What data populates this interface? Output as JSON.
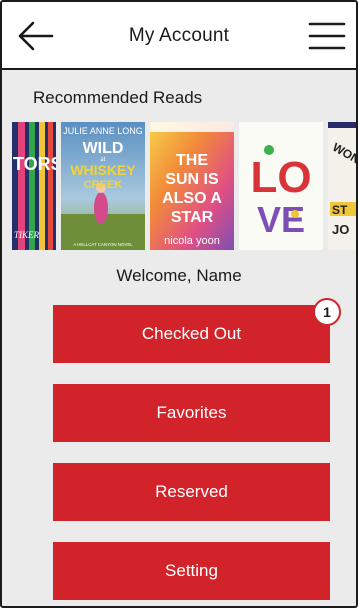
{
  "header": {
    "title": "My Account",
    "back_icon": "arrow-left-icon",
    "menu_icon": "hamburger-menu-icon"
  },
  "recommended": {
    "title": "Recommended Reads",
    "books": [
      {
        "cover_text": [
          "TORS",
          "TIKER"
        ]
      },
      {
        "cover_text": [
          "JULIE ANNE LONG",
          "WILD",
          "at",
          "WHISKEY",
          "CREEK",
          "A HELLCAT CANYON NOVEL"
        ]
      },
      {
        "cover_text": [
          "THE",
          "SUN IS",
          "ALSO A",
          "STAR",
          "nicola yoon"
        ]
      },
      {
        "cover_text": [
          "LO",
          "VE"
        ]
      },
      {
        "cover_text": [
          "WON",
          "ST",
          "JO"
        ]
      }
    ]
  },
  "welcome": "Welcome, Name",
  "buttons": {
    "checked_out": "Checked Out",
    "favorites": "Favorites",
    "reserved": "Reserved",
    "setting": "Setting"
  },
  "checked_out_count": "1",
  "colors": {
    "accent": "#d2232a",
    "background": "#ebebeb",
    "header": "#ffffff"
  }
}
